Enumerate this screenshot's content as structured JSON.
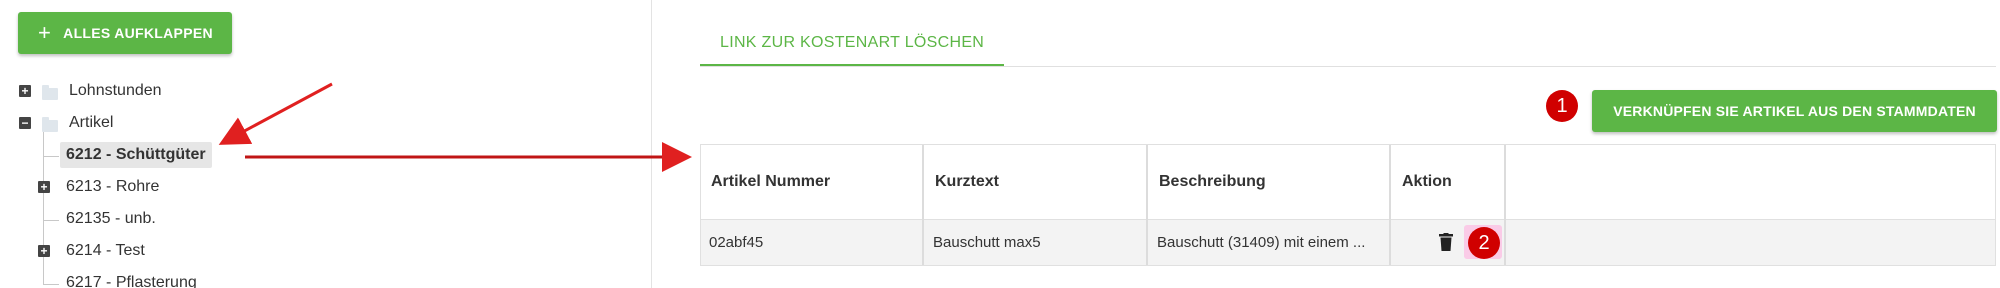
{
  "left_panel": {
    "expand_all_label": "ALLES AUFKLAPPEN",
    "tree": [
      {
        "label": "Lohnstunden",
        "toggle": "+"
      },
      {
        "label": "Artikel",
        "toggle": "−"
      },
      {
        "label": "6212 - Schüttgüter",
        "selected": true
      },
      {
        "label": "6213 - Rohre",
        "toggle": "+"
      },
      {
        "label": "62135 - unb."
      },
      {
        "label": "6214 - Test",
        "toggle": "+"
      },
      {
        "label": "6217 - Pflasterung"
      }
    ]
  },
  "main": {
    "tab_label": "LINK ZUR KOSTENART LÖSCHEN",
    "link_button_label": "VERKNÜPFEN SIE ARTIKEL AUS DEN STAMMDATEN",
    "badges": [
      "1",
      "2"
    ],
    "table": {
      "headers": [
        "Artikel Nummer",
        "Kurztext",
        "Beschreibung",
        "Aktion"
      ],
      "rows": [
        [
          "02abf45",
          "Bauschutt max5",
          "Bauschutt (31409) mit einem ..."
        ]
      ]
    }
  },
  "colors": {
    "accent": "#5cb646",
    "badge": "#d00000",
    "annotation_arrow": "#e02020"
  },
  "icons": [
    "plus-icon",
    "folder-icon",
    "trash-icon"
  ]
}
